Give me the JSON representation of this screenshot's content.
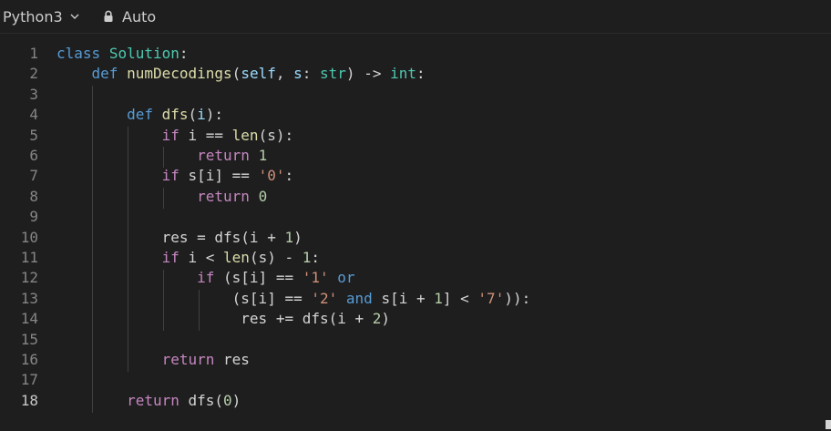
{
  "toolbar": {
    "language": "Python3",
    "mode": "Auto",
    "chevron_icon": "chevron-down-icon",
    "lock_icon": "lock-icon"
  },
  "editor": {
    "active_line": 18,
    "lines": [
      {
        "n": "1",
        "tokens": [
          [
            "k",
            "class"
          ],
          [
            "",
            " "
          ],
          [
            "cls",
            "Solution"
          ],
          [
            "",
            ":"
          ]
        ]
      },
      {
        "n": "2",
        "tokens": [
          [
            "",
            "    "
          ],
          [
            "k",
            "def"
          ],
          [
            "",
            " "
          ],
          [
            "fn",
            "numDecodings"
          ],
          [
            "",
            "("
          ],
          [
            "par",
            "self"
          ],
          [
            "",
            ", "
          ],
          [
            "par",
            "s"
          ],
          [
            "",
            ": "
          ],
          [
            "cls",
            "str"
          ],
          [
            "",
            ") -> "
          ],
          [
            "cls",
            "int"
          ],
          [
            "",
            ":"
          ]
        ]
      },
      {
        "n": "3",
        "tokens": []
      },
      {
        "n": "4",
        "tokens": [
          [
            "",
            "        "
          ],
          [
            "k",
            "def"
          ],
          [
            "",
            " "
          ],
          [
            "fn",
            "dfs"
          ],
          [
            "",
            "("
          ],
          [
            "par",
            "i"
          ],
          [
            "",
            "):"
          ]
        ]
      },
      {
        "n": "5",
        "tokens": [
          [
            "",
            "            "
          ],
          [
            "kc",
            "if"
          ],
          [
            "",
            " i == "
          ],
          [
            "fn",
            "len"
          ],
          [
            "",
            "(s):"
          ]
        ]
      },
      {
        "n": "6",
        "tokens": [
          [
            "",
            "                "
          ],
          [
            "kc",
            "return"
          ],
          [
            "",
            " "
          ],
          [
            "num",
            "1"
          ]
        ]
      },
      {
        "n": "7",
        "tokens": [
          [
            "",
            "            "
          ],
          [
            "kc",
            "if"
          ],
          [
            "",
            " s[i] == "
          ],
          [
            "str",
            "'0'"
          ],
          [
            "",
            ":"
          ]
        ]
      },
      {
        "n": "8",
        "tokens": [
          [
            "",
            "                "
          ],
          [
            "kc",
            "return"
          ],
          [
            "",
            " "
          ],
          [
            "num",
            "0"
          ]
        ]
      },
      {
        "n": "9",
        "tokens": []
      },
      {
        "n": "10",
        "tokens": [
          [
            "",
            "            res = dfs(i + "
          ],
          [
            "num",
            "1"
          ],
          [
            "",
            ")"
          ]
        ]
      },
      {
        "n": "11",
        "tokens": [
          [
            "",
            "            "
          ],
          [
            "kc",
            "if"
          ],
          [
            "",
            " i < "
          ],
          [
            "fn",
            "len"
          ],
          [
            "",
            "(s) - "
          ],
          [
            "num",
            "1"
          ],
          [
            "",
            ":"
          ]
        ]
      },
      {
        "n": "12",
        "tokens": [
          [
            "",
            "                "
          ],
          [
            "kc",
            "if"
          ],
          [
            "",
            " (s[i] == "
          ],
          [
            "str",
            "'1'"
          ],
          [
            "",
            " "
          ],
          [
            "k",
            "or"
          ]
        ]
      },
      {
        "n": "13",
        "tokens": [
          [
            "",
            "                    (s[i] == "
          ],
          [
            "str",
            "'2'"
          ],
          [
            "",
            " "
          ],
          [
            "k",
            "and"
          ],
          [
            "",
            " s[i + "
          ],
          [
            "num",
            "1"
          ],
          [
            "",
            "] < "
          ],
          [
            "str",
            "'7'"
          ],
          [
            "",
            "))"
          ],
          [
            "",
            ":"
          ]
        ]
      },
      {
        "n": "14",
        "tokens": [
          [
            "",
            "                     res += dfs(i + "
          ],
          [
            "num",
            "2"
          ],
          [
            "",
            ")"
          ]
        ]
      },
      {
        "n": "15",
        "tokens": []
      },
      {
        "n": "16",
        "tokens": [
          [
            "",
            "            "
          ],
          [
            "kc",
            "return"
          ],
          [
            "",
            " res"
          ]
        ]
      },
      {
        "n": "17",
        "tokens": []
      },
      {
        "n": "18",
        "tokens": [
          [
            "",
            "        "
          ],
          [
            "kc",
            "return"
          ],
          [
            "",
            " dfs("
          ],
          [
            "num",
            "0"
          ],
          [
            "",
            ")"
          ]
        ]
      }
    ]
  },
  "colors": {
    "background": "#1e1e1e",
    "keyword": "#569cd6",
    "control_keyword": "#c586c0",
    "class_name": "#4ec9b0",
    "function": "#dcdcaa",
    "parameter": "#9cdcfe",
    "number": "#b5cea8",
    "string": "#ce9178",
    "default_text": "#d4d4d4",
    "line_number": "#858585"
  }
}
